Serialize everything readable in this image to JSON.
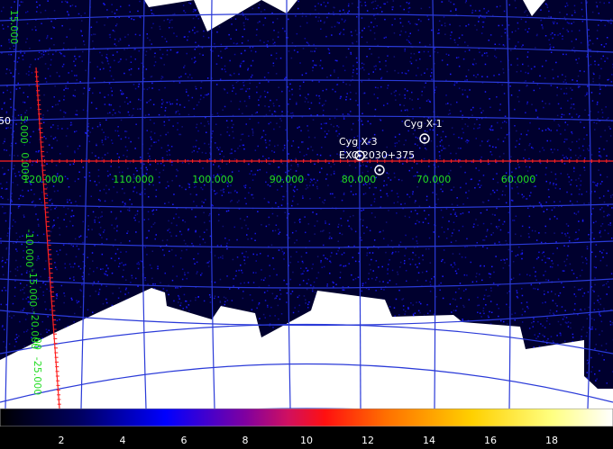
{
  "colors": {
    "background": "#000000",
    "exposure": "#00002e",
    "noise": "#1414d8",
    "grid": "#2a3ad8",
    "axis_line": "#ff2020",
    "axis_labels": "#22dd22",
    "source": "#ffffff",
    "unexposed": "#ffffff"
  },
  "sky": {
    "lon_labels": [
      "120.000",
      "110.000",
      "100.000",
      "90.000",
      "80.000",
      "70.000",
      "60.000"
    ],
    "lat_labels_top": [
      "15.000",
      "5.000",
      "0.000"
    ],
    "lat_labels_bottom": [
      "-10.000",
      "-15.000",
      "-20.000",
      "-25.000"
    ],
    "edge_fragments": [
      "50",
      "00"
    ]
  },
  "sources": [
    {
      "name": "Cyg X-1"
    },
    {
      "name": "Cyg X-3"
    },
    {
      "name": "EXO 2030+375"
    }
  ],
  "colorbar": {
    "min": 0,
    "max": 20,
    "ticks": [
      "2",
      "4",
      "6",
      "8",
      "10",
      "12",
      "14",
      "16",
      "18"
    ],
    "colormap": "heat"
  }
}
